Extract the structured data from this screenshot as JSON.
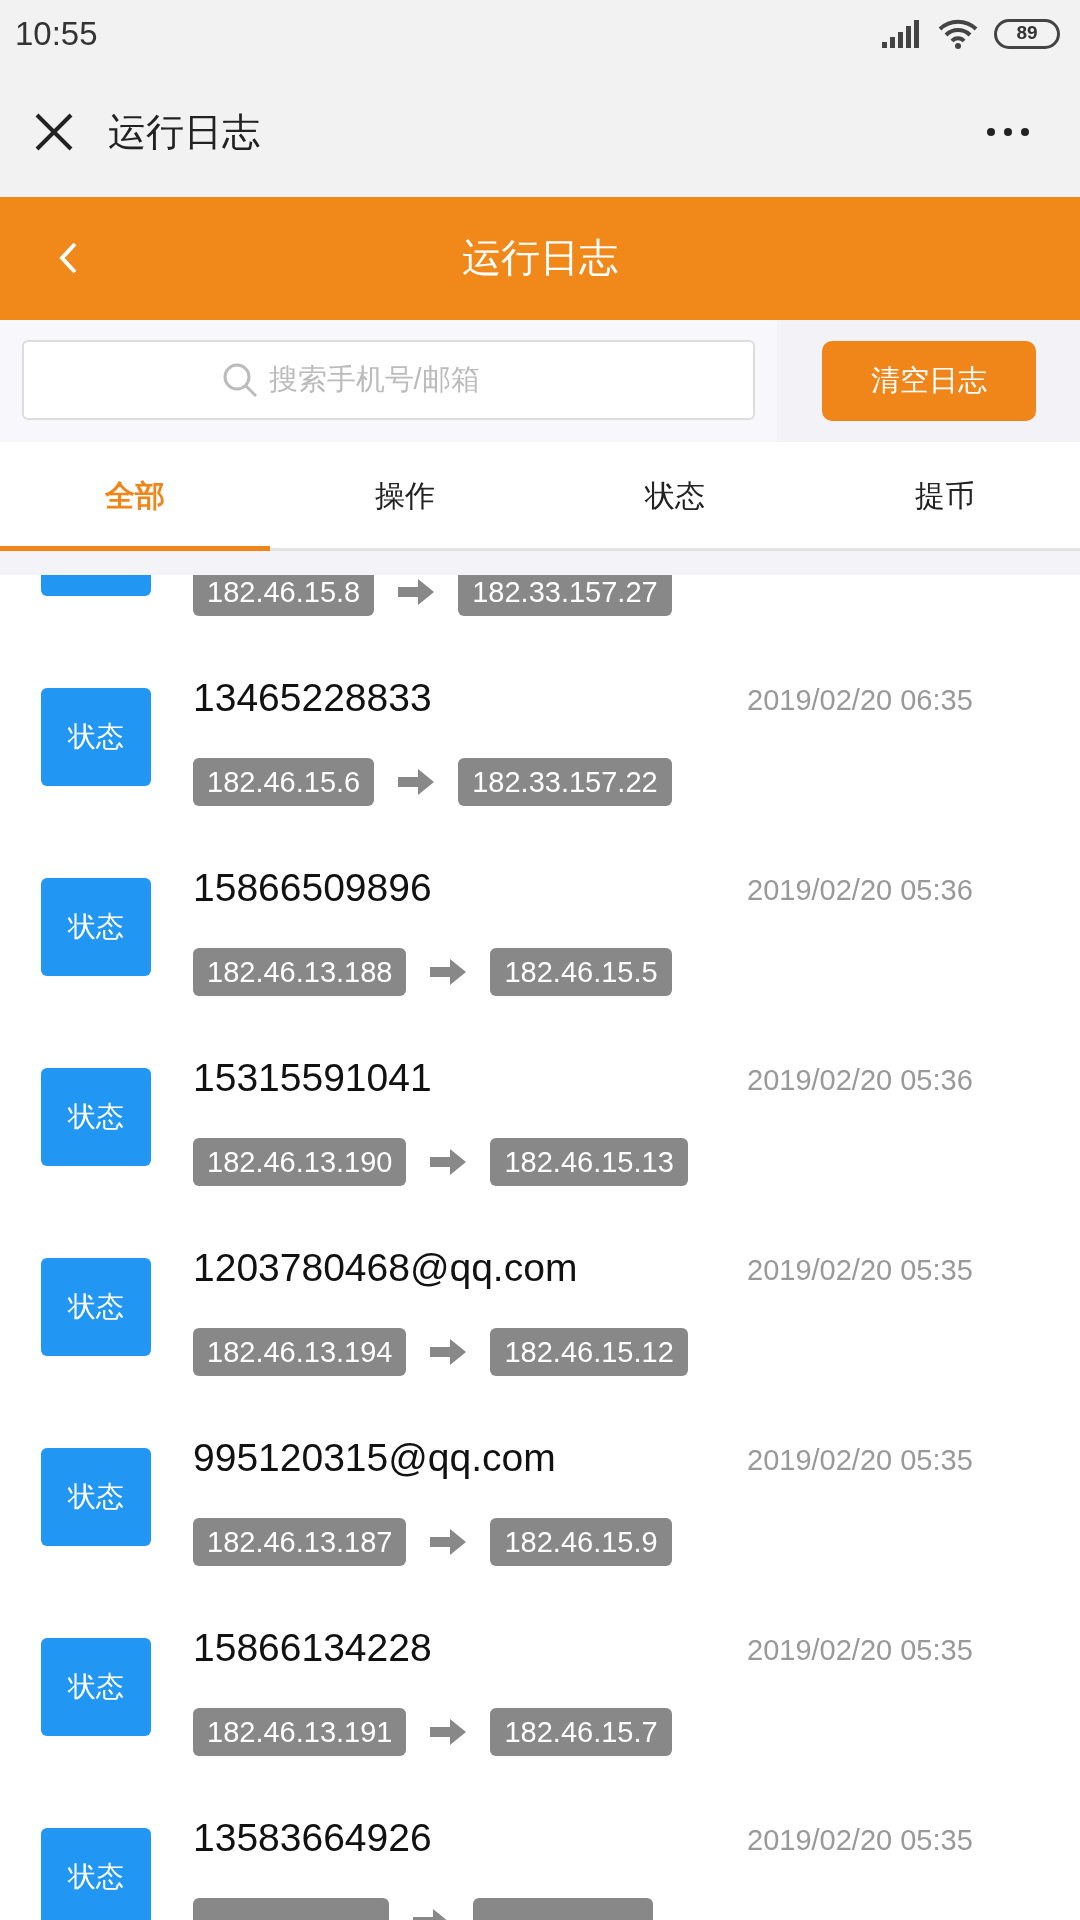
{
  "status_bar": {
    "time": "10:55",
    "battery": "89"
  },
  "app_bar": {
    "title": "运行日志"
  },
  "header": {
    "title": "运行日志"
  },
  "search": {
    "placeholder": "搜索手机号/邮箱"
  },
  "clear_button": "清空日志",
  "tabs": [
    {
      "label": "全部",
      "selected": true
    },
    {
      "label": "操作",
      "selected": false
    },
    {
      "label": "状态",
      "selected": false
    },
    {
      "label": "提币",
      "selected": false
    }
  ],
  "logs": [
    {
      "from": "182.46.15.8",
      "to": "182.33.157.27"
    },
    {
      "type": "状态",
      "account": "13465228833",
      "time": "2019/02/20 06:35",
      "from": "182.46.15.6",
      "to": "182.33.157.22"
    },
    {
      "type": "状态",
      "account": "15866509896",
      "time": "2019/02/20 05:36",
      "from": "182.46.13.188",
      "to": "182.46.15.5"
    },
    {
      "type": "状态",
      "account": "15315591041",
      "time": "2019/02/20 05:36",
      "from": "182.46.13.190",
      "to": "182.46.15.13"
    },
    {
      "type": "状态",
      "account": "1203780468@qq.com",
      "time": "2019/02/20 05:35",
      "from": "182.46.13.194",
      "to": "182.46.15.12"
    },
    {
      "type": "状态",
      "account": "995120315@qq.com",
      "time": "2019/02/20 05:35",
      "from": "182.46.13.187",
      "to": "182.46.15.9"
    },
    {
      "type": "状态",
      "account": "15866134228",
      "time": "2019/02/20 05:35",
      "from": "182.46.13.191",
      "to": "182.46.15.7"
    },
    {
      "type": "状态",
      "account": "13583664926",
      "time": "2019/02/20 05:35"
    }
  ]
}
